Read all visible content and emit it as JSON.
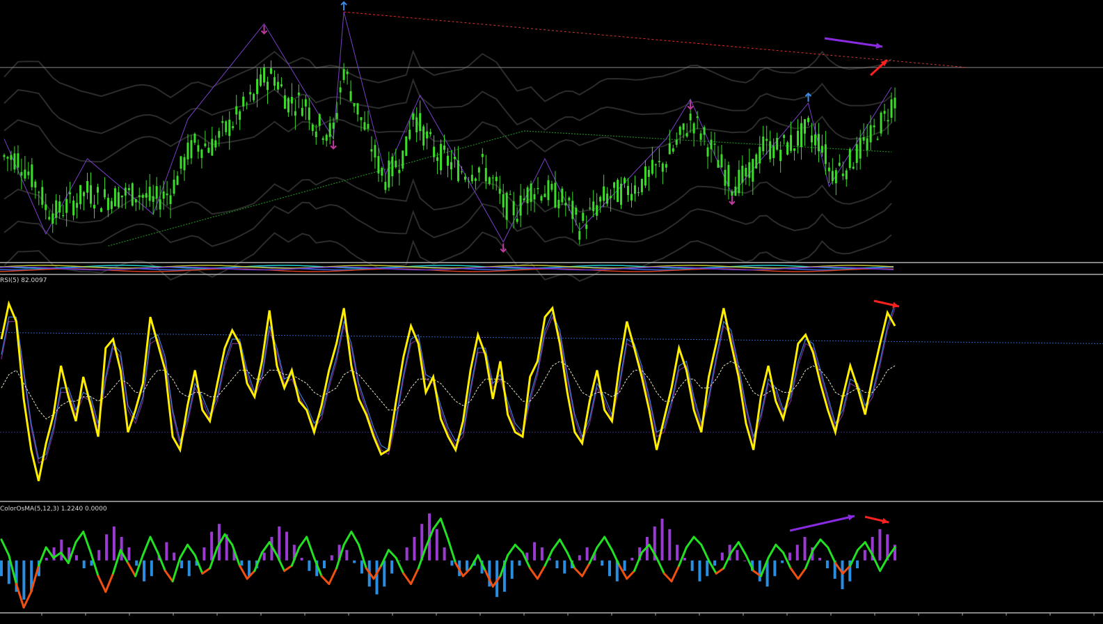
{
  "window": {
    "title": ""
  },
  "colors": {
    "background": "#000000",
    "candle": "#3cdc2a",
    "zigzag": "#7a3fc8",
    "ma_dotted": "#1e8c1e",
    "bands": "#2a2d2a",
    "resistance": "#e03030",
    "rsi": "#ffee00",
    "rsi_fast": "#3a7ad8",
    "rsi_slow": "#7a2a8a",
    "rsi_signal": "#e8e8c8",
    "level_upper": "#3060c0",
    "level_lower": "#3a2a7a",
    "hist_pos": "#9a3ad0",
    "hist_neg": "#2a8ee0",
    "osma_line_up": "#22e022",
    "osma_line_down": "#f05010",
    "arrow_red": "#ff2020",
    "arrow_purple": "#8a2be2",
    "fractal_up": "#3a8ae8",
    "fractal_down": "#c03aa0",
    "separator": "#b0b0b0"
  },
  "panes": {
    "rsi": {
      "label": "RSI(5) 82.0097"
    },
    "osma": {
      "label": "ColorOsMA(5,12,3) 1.2240 0.0000"
    }
  },
  "icons": {
    "fractal_up": "fractal-up-arrow-icon",
    "fractal_down": "fractal-down-arrow-icon",
    "divergence_arrow": "divergence-arrow-icon"
  },
  "chart_data": [
    {
      "type": "candlestick",
      "title": "",
      "pane": "price",
      "bars": 258,
      "close_path": [
        [
          0,
          -0.2
        ],
        [
          4,
          0.25
        ],
        [
          10,
          0.15
        ],
        [
          15,
          -0.6
        ],
        [
          22,
          -0.85
        ],
        [
          28,
          -0.9
        ],
        [
          35,
          -0.45
        ],
        [
          39,
          -0.25
        ],
        [
          43,
          -0.3
        ],
        [
          48,
          -0.75
        ],
        [
          55,
          -0.3
        ],
        [
          60,
          -0.65
        ],
        [
          66,
          -0.4
        ],
        [
          72,
          -0.1
        ],
        [
          78,
          0.55
        ],
        [
          82,
          0.2
        ],
        [
          87,
          0.6
        ],
        [
          90,
          0.25
        ],
        [
          95,
          0.45
        ],
        [
          98,
          0.3
        ],
        [
          101,
          0.05
        ],
        [
          108,
          -0.28
        ],
        [
          116,
          -0.2
        ],
        [
          118,
          0.6
        ],
        [
          120,
          0.0
        ],
        [
          124,
          -0.35
        ],
        [
          128,
          -0.25
        ],
        [
          133,
          -0.1
        ],
        [
          138,
          0.55
        ],
        [
          142,
          0.35
        ],
        [
          148,
          -0.55
        ],
        [
          152,
          -0.35
        ],
        [
          156,
          -0.85
        ],
        [
          160,
          -0.6
        ],
        [
          163,
          -0.5
        ],
        [
          166,
          -0.75
        ],
        [
          170,
          -0.55
        ],
        [
          173,
          -0.35
        ],
        [
          178,
          -0.45
        ],
        [
          183,
          -0.55
        ],
        [
          190,
          -0.35
        ],
        [
          195,
          -0.05
        ],
        [
          199,
          0.3
        ],
        [
          204,
          0.15
        ],
        [
          210,
          -0.1
        ],
        [
          215,
          -0.2
        ],
        [
          219,
          0.35
        ],
        [
          223,
          0.05
        ],
        [
          228,
          -0.1
        ],
        [
          233,
          0.05
        ],
        [
          236,
          0.5
        ],
        [
          239,
          0.05
        ],
        [
          243,
          -0.15
        ],
        [
          249,
          0.0
        ],
        [
          254,
          0.25
        ],
        [
          257,
          0.6
        ]
      ],
      "zigzag": [
        [
          0,
          0.3
        ],
        [
          12,
          -0.9
        ],
        [
          24,
          0.05
        ],
        [
          43,
          -0.65
        ],
        [
          53,
          0.55
        ],
        [
          75,
          1.75
        ],
        [
          95,
          0.3
        ],
        [
          98,
          1.9
        ],
        [
          110,
          -0.15
        ],
        [
          120,
          0.85
        ],
        [
          144,
          -1.0
        ],
        [
          156,
          0.05
        ],
        [
          166,
          -0.85
        ],
        [
          191,
          0.3
        ],
        [
          198,
          0.8
        ],
        [
          210,
          -0.4
        ],
        [
          232,
          0.75
        ],
        [
          238,
          -0.3
        ],
        [
          256,
          0.95
        ]
      ],
      "fractal_up_arrows": [
        [
          98,
          1.9
        ],
        [
          232,
          0.75
        ]
      ],
      "fractal_down_arrows": [
        [
          75,
          1.75
        ],
        [
          95,
          0.3
        ],
        [
          144,
          -1.0
        ],
        [
          198,
          0.8
        ],
        [
          210,
          -0.4
        ]
      ],
      "resistance_line": {
        "from": [
          98,
          1.9
        ],
        "to_x": 1390
      },
      "horizontal_level": 1.2,
      "ylim": [
        -1.25,
        2.05
      ]
    },
    {
      "type": "line",
      "pane": "rsi",
      "series": [
        {
          "values": [
            72,
            88,
            80,
            45,
            22,
            8,
            25,
            38,
            60,
            46,
            35,
            55,
            42,
            28,
            68,
            72,
            58,
            30,
            40,
            52,
            82,
            70,
            58,
            28,
            22,
            42,
            58,
            40,
            35,
            52,
            68,
            76,
            70,
            52,
            46,
            62,
            85,
            60,
            50,
            58,
            44,
            40,
            30,
            42,
            58,
            70,
            86,
            60,
            45,
            38,
            28,
            20,
            22,
            44,
            64,
            78,
            70,
            48,
            55,
            36,
            28,
            22,
            35,
            58,
            74,
            65,
            45,
            62,
            38,
            30,
            28,
            55,
            62,
            82,
            86,
            70,
            48,
            30,
            25,
            44,
            58,
            40,
            35,
            60,
            80,
            68,
            55,
            40,
            22,
            36,
            50,
            68,
            58,
            40,
            30,
            55,
            70,
            86,
            70,
            55,
            34,
            22,
            46,
            60,
            44,
            36,
            50,
            70,
            74,
            66,
            52,
            40,
            30,
            46,
            60,
            50,
            38,
            55,
            70,
            84,
            78
          ]
        },
        {
          "values": [
            65,
            82,
            82,
            58,
            34,
            18,
            20,
            32,
            50,
            50,
            40,
            48,
            46,
            34,
            55,
            70,
            66,
            42,
            36,
            46,
            72,
            74,
            64,
            40,
            26,
            36,
            52,
            46,
            38,
            46,
            62,
            72,
            72,
            58,
            48,
            56,
            78,
            68,
            54,
            56,
            48,
            42,
            34,
            38,
            52,
            64,
            80,
            70,
            52,
            42,
            32,
            24,
            22,
            36,
            56,
            72,
            74,
            56,
            54,
            42,
            32,
            26,
            30,
            50,
            68,
            68,
            52,
            56,
            44,
            34,
            30,
            46,
            58,
            76,
            84,
            76,
            56,
            38,
            28,
            36,
            52,
            46,
            38,
            52,
            72,
            70,
            60,
            46,
            30,
            32,
            44,
            60,
            62,
            46,
            34,
            46,
            64,
            80,
            76,
            60,
            42,
            28,
            38,
            54,
            50,
            40,
            46,
            62,
            72,
            70,
            58,
            46,
            34,
            40,
            54,
            52,
            42,
            48,
            62,
            78,
            88
          ]
        },
        {
          "values": [
            50,
            56,
            58,
            52,
            46,
            40,
            36,
            38,
            42,
            44,
            44,
            46,
            46,
            44,
            46,
            50,
            54,
            52,
            48,
            48,
            54,
            58,
            58,
            54,
            48,
            46,
            48,
            48,
            46,
            46,
            50,
            54,
            58,
            58,
            54,
            54,
            58,
            58,
            56,
            56,
            54,
            52,
            48,
            46,
            48,
            50,
            56,
            58,
            56,
            52,
            48,
            44,
            40,
            40,
            44,
            50,
            54,
            54,
            54,
            52,
            48,
            44,
            42,
            44,
            50,
            54,
            54,
            54,
            52,
            48,
            44,
            44,
            48,
            54,
            60,
            62,
            60,
            54,
            48,
            46,
            48,
            48,
            46,
            48,
            54,
            58,
            58,
            54,
            48,
            44,
            44,
            50,
            54,
            54,
            50,
            50,
            54,
            60,
            62,
            60,
            54,
            48,
            46,
            48,
            50,
            48,
            48,
            52,
            58,
            60,
            58,
            54,
            48,
            46,
            48,
            50,
            48,
            48,
            52,
            58,
            60
          ]
        }
      ],
      "levels": {
        "upper": [
          75,
          70
        ],
        "lower": 30
      },
      "ylim": [
        0,
        100
      ]
    },
    {
      "type": "bar",
      "pane": "osma",
      "histogram": [
        -0.6,
        -0.9,
        -1.2,
        -1.5,
        -1.2,
        -0.6,
        0.1,
        0.5,
        0.8,
        0.5,
        0.2,
        -0.3,
        -0.2,
        0.4,
        1.0,
        1.3,
        0.9,
        0.5,
        -0.2,
        -0.8,
        -0.6,
        0.2,
        0.7,
        0.3,
        -0.3,
        -0.6,
        -0.2,
        0.5,
        1.1,
        1.4,
        1.0,
        0.4,
        -0.2,
        -0.6,
        -0.3,
        0.3,
        0.9,
        1.3,
        1.1,
        0.6,
        0.1,
        -0.4,
        -0.6,
        -0.3,
        0.2,
        0.6,
        0.4,
        -0.1,
        -0.5,
        -1.0,
        -1.3,
        -1.0,
        -0.5,
        0.0,
        0.5,
        0.9,
        1.4,
        1.8,
        1.2,
        0.5,
        -0.2,
        -0.6,
        -0.4,
        -0.2,
        -0.5,
        -1.0,
        -1.4,
        -1.2,
        -0.7,
        -0.2,
        0.3,
        0.7,
        0.5,
        0.1,
        -0.3,
        -0.5,
        -0.3,
        0.2,
        0.5,
        0.3,
        -0.2,
        -0.6,
        -0.8,
        -0.4,
        0.1,
        0.5,
        0.9,
        1.3,
        1.6,
        1.2,
        0.6,
        0.1,
        -0.4,
        -0.8,
        -0.6,
        -0.2,
        0.3,
        0.6,
        0.4,
        0.0,
        -0.4,
        -0.8,
        -1.0,
        -0.6,
        -0.1,
        0.3,
        0.6,
        0.9,
        0.5,
        0.1,
        -0.3,
        -0.7,
        -1.1,
        -0.8,
        -0.3,
        0.4,
        0.9,
        1.2,
        1.0,
        0.6
      ],
      "osma_line": [
        0.8,
        0.2,
        -0.9,
        -1.8,
        -1.2,
        -0.2,
        0.5,
        0.1,
        0.3,
        -0.1,
        0.7,
        1.1,
        0.3,
        -0.6,
        -1.2,
        -0.5,
        0.4,
        -0.1,
        -0.6,
        0.2,
        0.9,
        0.3,
        -0.4,
        -0.8,
        0.1,
        0.6,
        0.2,
        -0.5,
        -0.3,
        0.5,
        1.0,
        0.6,
        -0.2,
        -0.7,
        -0.4,
        0.3,
        0.7,
        0.2,
        -0.4,
        -0.2,
        0.5,
        0.9,
        0.1,
        -0.6,
        -0.9,
        -0.3,
        0.6,
        1.1,
        0.6,
        -0.3,
        -0.7,
        -0.2,
        0.4,
        0.1,
        -0.5,
        -0.9,
        -0.3,
        0.5,
        1.2,
        1.6,
        0.8,
        -0.1,
        -0.6,
        -0.3,
        0.2,
        -0.4,
        -1.0,
        -0.6,
        0.2,
        0.6,
        0.3,
        -0.3,
        -0.7,
        -0.2,
        0.4,
        0.8,
        0.3,
        -0.3,
        -0.6,
        -0.1,
        0.5,
        0.9,
        0.4,
        -0.2,
        -0.7,
        -0.4,
        0.3,
        0.6,
        0.1,
        -0.5,
        -0.8,
        -0.2,
        0.5,
        0.9,
        0.6,
        0.0,
        -0.5,
        -0.3,
        0.3,
        0.7,
        0.2,
        -0.4,
        -0.6,
        0.1,
        0.6,
        0.3,
        -0.3,
        -0.7,
        -0.3,
        0.4,
        0.8,
        0.5,
        -0.1,
        -0.5,
        -0.2,
        0.4,
        0.7,
        0.2,
        -0.4,
        0.1,
        0.5
      ],
      "ylim": [
        -1.9,
        2.1
      ]
    }
  ]
}
